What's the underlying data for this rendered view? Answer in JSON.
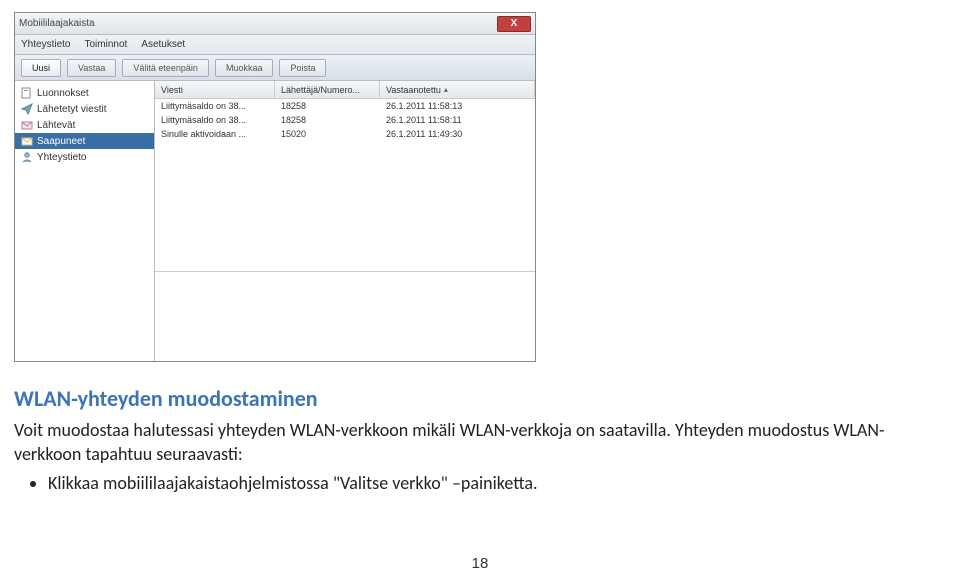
{
  "window": {
    "title": "Mobiililaajakaista",
    "close": "X"
  },
  "menubar": [
    "Yhteystieto",
    "Toiminnot",
    "Asetukset"
  ],
  "toolbar": [
    {
      "label": "Uusi",
      "active": true
    },
    {
      "label": "Vastaa",
      "active": false
    },
    {
      "label": "Välitä eteenpäin",
      "active": false
    },
    {
      "label": "Muokkaa",
      "active": false
    },
    {
      "label": "Poista",
      "active": false
    }
  ],
  "folders": [
    {
      "name": "Luonnokset",
      "icon": "draft"
    },
    {
      "name": "Lähetetyt viestit",
      "icon": "sent"
    },
    {
      "name": "Lähtevät",
      "icon": "outbox"
    },
    {
      "name": "Saapuneet",
      "icon": "inbox",
      "selected": true
    },
    {
      "name": "Yhteystieto",
      "icon": "contact"
    }
  ],
  "list_headers": {
    "c1": "Viesti",
    "c2": "Lähettäjä/Numero...",
    "c3": "Vastaanotettu"
  },
  "messages": [
    {
      "subject": "Liittymäsaldo on 38...",
      "from": "18258",
      "received": "26.1.2011 11:58:13"
    },
    {
      "subject": "Liittymäsaldo on 38...",
      "from": "18258",
      "received": "26.1.2011 11:58:11"
    },
    {
      "subject": "Sinulle aktivoidaan ...",
      "from": "15020",
      "received": "26.1.2011 11:49:30"
    }
  ],
  "doc": {
    "heading": "WLAN-yhteyden muodostaminen",
    "para1": "Voit muodostaa halutessasi yhteyden WLAN-verkkoon mikäli WLAN-verkkoja on saatavilla. Yhteyden muodostus WLAN-verkkoon tapahtuu seuraavasti:",
    "bullet1": "Klikkaa mobiililaajakaistaohjelmistossa \"Valitse verkko\" –painiketta.",
    "page": "18"
  }
}
